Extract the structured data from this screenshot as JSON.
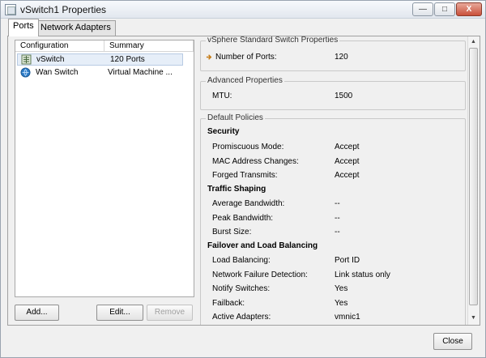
{
  "window": {
    "title": "vSwitch1 Properties",
    "min_glyph": "—",
    "max_glyph": "□",
    "close_glyph": "X"
  },
  "tabs": [
    {
      "label": "Ports",
      "active": true
    },
    {
      "label": "Network Adapters",
      "active": false
    }
  ],
  "list": {
    "headers": {
      "configuration": "Configuration",
      "summary": "Summary"
    },
    "rows": [
      {
        "name": "vSwitch",
        "summary": "120 Ports",
        "icon": "switch-icon",
        "selected": true
      },
      {
        "name": "Wan Switch",
        "summary": "Virtual Machine ...",
        "icon": "port-group-icon",
        "selected": false
      }
    ]
  },
  "buttons": {
    "add": "Add...",
    "edit": "Edit...",
    "remove": "Remove",
    "close": "Close"
  },
  "standard_switch": {
    "title": "vSphere Standard Switch Properties",
    "ports_label": "Number of Ports:",
    "ports_value": "120",
    "icon": "ports-arrow-icon"
  },
  "advanced": {
    "title": "Advanced Properties",
    "mtu_label": "MTU:",
    "mtu_value": "1500"
  },
  "policies": {
    "title": "Default Policies",
    "security": {
      "heading": "Security",
      "items": [
        {
          "k": "Promiscuous Mode:",
          "v": "Accept"
        },
        {
          "k": "MAC Address Changes:",
          "v": "Accept"
        },
        {
          "k": "Forged Transmits:",
          "v": "Accept"
        }
      ]
    },
    "traffic": {
      "heading": "Traffic Shaping",
      "items": [
        {
          "k": "Average Bandwidth:",
          "v": "--"
        },
        {
          "k": "Peak Bandwidth:",
          "v": "--"
        },
        {
          "k": "Burst Size:",
          "v": "--"
        }
      ]
    },
    "failover": {
      "heading": "Failover and Load Balancing",
      "items": [
        {
          "k": "Load Balancing:",
          "v": "Port ID"
        },
        {
          "k": "Network Failure Detection:",
          "v": "Link status only"
        },
        {
          "k": "Notify Switches:",
          "v": "Yes"
        },
        {
          "k": "Failback:",
          "v": "Yes"
        },
        {
          "k": "Active Adapters:",
          "v": "vmnic1"
        }
      ]
    }
  },
  "colors": {
    "accent": "#3a6fb0",
    "selection": "#e6eef8"
  }
}
